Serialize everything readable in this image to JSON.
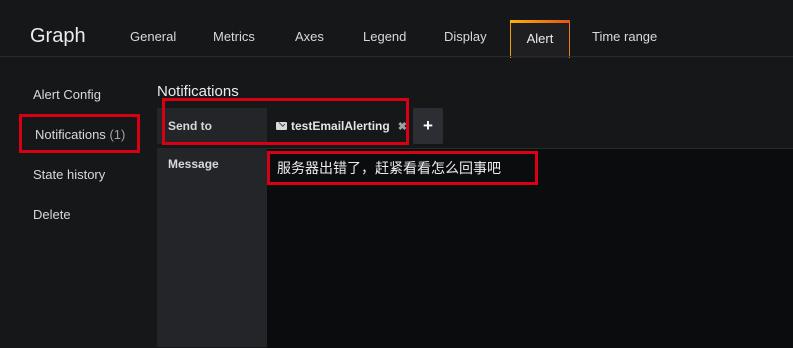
{
  "header": {
    "title": "Graph",
    "tabs": [
      {
        "label": "General"
      },
      {
        "label": "Metrics"
      },
      {
        "label": "Axes"
      },
      {
        "label": "Legend"
      },
      {
        "label": "Display"
      },
      {
        "label": "Alert",
        "active": true
      },
      {
        "label": "Time range"
      }
    ]
  },
  "sidebar": {
    "items": [
      {
        "label": "Alert Config"
      },
      {
        "label": "Notifications",
        "count": "(1)",
        "active": true
      },
      {
        "label": "State history"
      },
      {
        "label": "Delete"
      }
    ]
  },
  "notifications": {
    "section_title": "Notifications",
    "send_to_label": "Send to",
    "recipients": [
      {
        "name": "testEmailAlerting",
        "icon": "envelope-icon",
        "remove_glyph": "✖"
      }
    ],
    "add_glyph": "+",
    "message_label": "Message",
    "message_value": "服务器出错了，赶紧看看怎么回事吧"
  },
  "colors": {
    "accent_gradient_start": "#fbb20a",
    "accent_gradient_end": "#e3531a",
    "highlight_border": "#d80012"
  }
}
